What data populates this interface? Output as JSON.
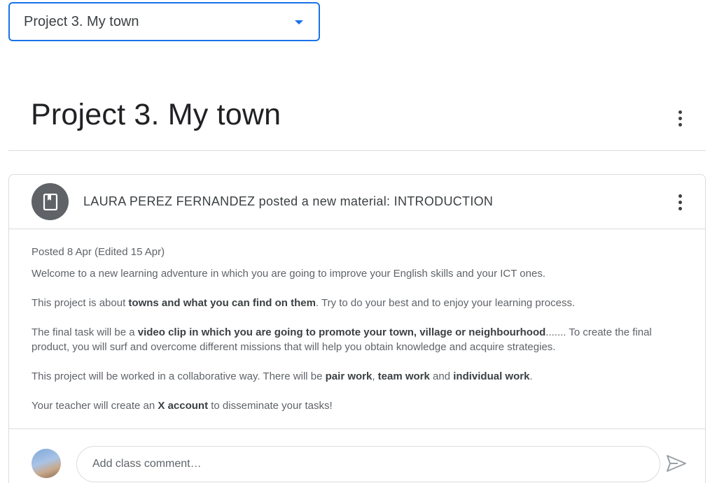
{
  "topic_selector": {
    "value": "Project 3. My town"
  },
  "page": {
    "title": "Project 3. My town"
  },
  "post": {
    "header": "LAURA PEREZ FERNANDEZ posted a new material: INTRODUCTION",
    "posted": "Posted 8 Apr (Edited 15 Apr)",
    "paragraphs": {
      "p1": "Welcome to a new learning adventure in which you are going to improve your English skills and your ICT ones.",
      "p2": {
        "a": "This project is about ",
        "b": "towns and what you can find on them",
        "c": ". Try to do your best and to enjoy your learning process."
      },
      "p3": {
        "a": "The final task will be a ",
        "b": "video clip in which you are going to promote your town, village or neighbourhood",
        "c": "....... To create the final product, you will surf and overcome different missions that will help you obtain knowledge and acquire strategies."
      },
      "p4": {
        "a": "This project will be worked in a collaborative way. There will be ",
        "b": "pair work",
        "c": ", ",
        "d": "team work",
        "e": " and ",
        "f": "individual work",
        "g": "."
      },
      "p5": {
        "a": "Your teacher will create an ",
        "b": "X account",
        "c": " to disseminate your tasks!"
      }
    }
  },
  "comment": {
    "placeholder": "Add class comment…"
  },
  "colors": {
    "accent": "#1a73e8",
    "text": "#3c4043",
    "muted": "#5f6368",
    "border": "#dadce0"
  }
}
